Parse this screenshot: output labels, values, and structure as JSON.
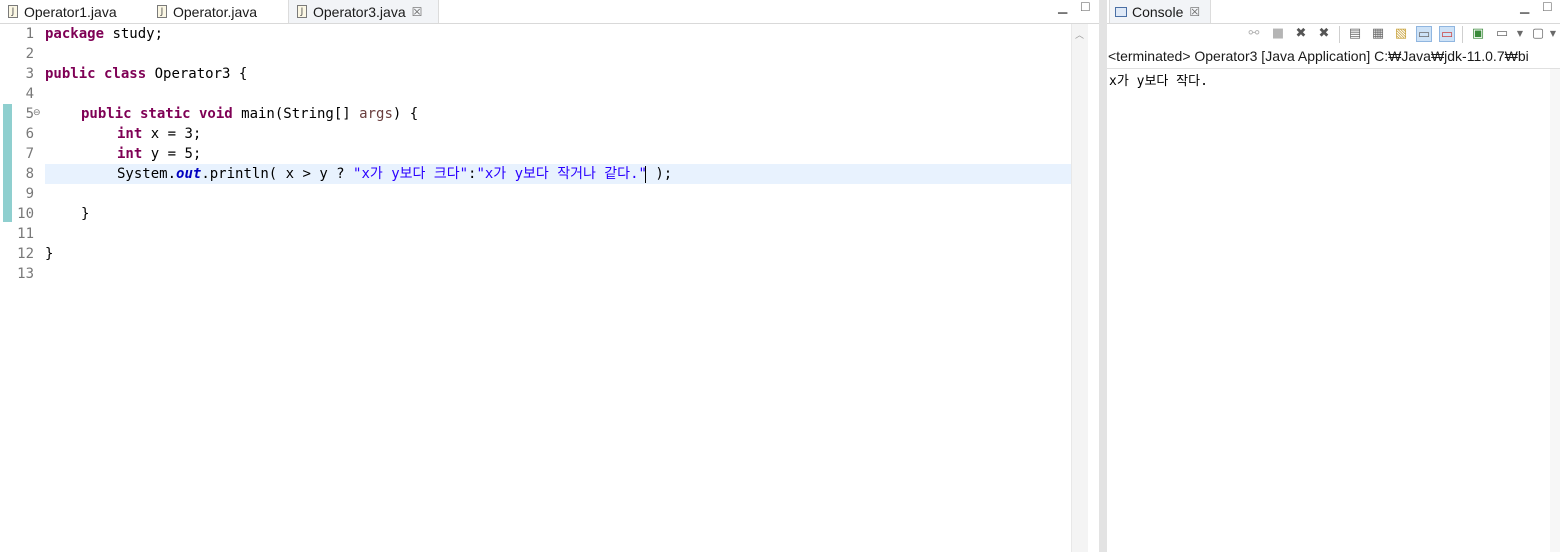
{
  "editor": {
    "tabs": [
      {
        "label": "Operator1.java",
        "active": false
      },
      {
        "label": "Operator.java",
        "active": false
      },
      {
        "label": "Operator3.java",
        "active": true
      }
    ],
    "tab_close_glyph": "☒",
    "lines": {
      "n1": "1",
      "n2": "2",
      "n3": "3",
      "n4": "4",
      "n5": "5",
      "n6": "6",
      "n7": "7",
      "n8": "8",
      "n9": "9",
      "n10": "10",
      "n11": "11",
      "n12": "12",
      "n13": "13"
    },
    "code": {
      "l1_kw": "package",
      "l1_rest": " study;",
      "l3_kw": "public class",
      "l3_rest": " Operator3 {",
      "l5_kw": "public static void",
      "l5_mid": " main(String[] ",
      "l5_var": "args",
      "l5_end": ") {",
      "l6_kw": "int",
      "l6_rest": " x = 3;",
      "l7_kw": "int",
      "l7_rest": " y = 5;",
      "l8_a": "System.",
      "l8_field": "out",
      "l8_b": ".println( x > y ? ",
      "l8_str1": "\"x가 y보다 크다\"",
      "l8_c": ":",
      "l8_str2": "\"x가 y보다 작거나 같다.\"",
      "l8_d": " );",
      "l10": "}",
      "l12": "}"
    }
  },
  "console": {
    "tab_label": "Console",
    "description": "<terminated> Operator3 [Java Application] C:₩Java₩jdk-11.0.7₩bi",
    "output_line1": "x가 y보다 작다."
  },
  "colors": {
    "keyword": "#7f0055",
    "string": "#2a00ff",
    "field": "#0000c0",
    "current_line": "#e8f2fe",
    "change_bar": "#8fcfcf"
  }
}
